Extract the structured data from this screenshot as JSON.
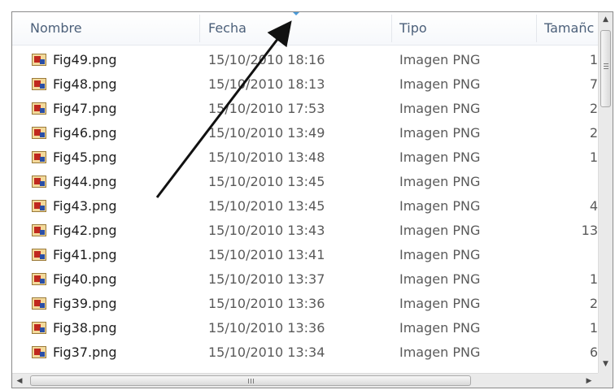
{
  "columns": {
    "name": "Nombre",
    "date": "Fecha",
    "type": "Tipo",
    "size": "Tamañc"
  },
  "files": [
    {
      "name": "Fig49.png",
      "date": "15/10/2010 18:16",
      "type": "Imagen PNG",
      "size": "1"
    },
    {
      "name": "Fig48.png",
      "date": "15/10/2010 18:13",
      "type": "Imagen PNG",
      "size": "7"
    },
    {
      "name": "Fig47.png",
      "date": "15/10/2010 17:53",
      "type": "Imagen PNG",
      "size": "2"
    },
    {
      "name": "Fig46.png",
      "date": "15/10/2010 13:49",
      "type": "Imagen PNG",
      "size": "2"
    },
    {
      "name": "Fig45.png",
      "date": "15/10/2010 13:48",
      "type": "Imagen PNG",
      "size": "1"
    },
    {
      "name": "Fig44.png",
      "date": "15/10/2010 13:45",
      "type": "Imagen PNG",
      "size": ""
    },
    {
      "name": "Fig43.png",
      "date": "15/10/2010 13:45",
      "type": "Imagen PNG",
      "size": "4"
    },
    {
      "name": "Fig42.png",
      "date": "15/10/2010 13:43",
      "type": "Imagen PNG",
      "size": "13"
    },
    {
      "name": "Fig41.png",
      "date": "15/10/2010 13:41",
      "type": "Imagen PNG",
      "size": ""
    },
    {
      "name": "Fig40.png",
      "date": "15/10/2010 13:37",
      "type": "Imagen PNG",
      "size": "1"
    },
    {
      "name": "Fig39.png",
      "date": "15/10/2010 13:36",
      "type": "Imagen PNG",
      "size": "2"
    },
    {
      "name": "Fig38.png",
      "date": "15/10/2010 13:36",
      "type": "Imagen PNG",
      "size": "1"
    },
    {
      "name": "Fig37.png",
      "date": "15/10/2010 13:34",
      "type": "Imagen PNG",
      "size": "6"
    }
  ],
  "scrollbars": {
    "up_glyph": "▲",
    "down_glyph": "▼",
    "left_glyph": "◀",
    "right_glyph": "▶"
  },
  "icons": {
    "file": "png-file-icon",
    "sort": "sort-indicator-icon",
    "annotation": "annotation-arrow"
  },
  "colors": {
    "header_text": "#4c607a",
    "sort_indicator": "#4a9ad8",
    "annotation_arrow": "#111111"
  }
}
